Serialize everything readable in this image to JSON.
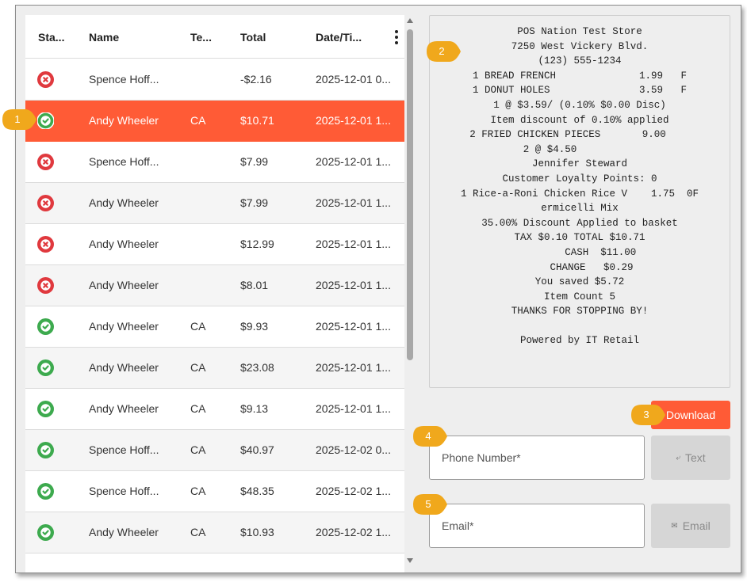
{
  "table": {
    "headers": {
      "status": "Sta...",
      "name": "Name",
      "tender": "Te...",
      "total": "Total",
      "date": "Date/Ti..."
    },
    "rows": [
      {
        "status": "void",
        "name": "Spence Hoff...",
        "tender": "",
        "total": "-$2.16",
        "date": "2025-12-01 0..."
      },
      {
        "status": "complete",
        "name": "Andy Wheeler",
        "tender": "CA",
        "total": "$10.71",
        "date": "2025-12-01 1..."
      },
      {
        "status": "void",
        "name": "Spence Hoff...",
        "tender": "",
        "total": "$7.99",
        "date": "2025-12-01 1..."
      },
      {
        "status": "void",
        "name": "Andy Wheeler",
        "tender": "",
        "total": "$7.99",
        "date": "2025-12-01 1..."
      },
      {
        "status": "void",
        "name": "Andy Wheeler",
        "tender": "",
        "total": "$12.99",
        "date": "2025-12-01 1..."
      },
      {
        "status": "void",
        "name": "Andy Wheeler",
        "tender": "",
        "total": "$8.01",
        "date": "2025-12-01 1..."
      },
      {
        "status": "complete",
        "name": "Andy Wheeler",
        "tender": "CA",
        "total": "$9.93",
        "date": "2025-12-01 1..."
      },
      {
        "status": "complete",
        "name": "Andy Wheeler",
        "tender": "CA",
        "total": "$23.08",
        "date": "2025-12-01 1..."
      },
      {
        "status": "complete",
        "name": "Andy Wheeler",
        "tender": "CA",
        "total": "$9.13",
        "date": "2025-12-01 1..."
      },
      {
        "status": "complete",
        "name": "Spence Hoff...",
        "tender": "CA",
        "total": "$40.97",
        "date": "2025-12-02 0..."
      },
      {
        "status": "complete",
        "name": "Spence Hoff...",
        "tender": "CA",
        "total": "$48.35",
        "date": "2025-12-02 1..."
      },
      {
        "status": "complete",
        "name": "Andy Wheeler",
        "tender": "CA",
        "total": "$10.93",
        "date": "2025-12-02 1..."
      }
    ],
    "selected_row": 1
  },
  "receipt": {
    "lines": [
      "POS Nation Test Store",
      "7250 West Vickery Blvd.",
      "(123) 555-1234",
      "1 BREAD FRENCH              1.99   F",
      "1 DONUT HOLES               3.59   F",
      "1 @ $3.59/ (0.10% $0.00 Disc)",
      "Item discount of 0.10% applied",
      "2 FRIED CHICKEN PIECES       9.00    ",
      "2 @ $4.50          ",
      "Jennifer Steward",
      "Customer Loyalty Points: 0",
      "1 Rice-a-Roni Chicken Rice V    1.75  0F",
      "ermicelli Mix",
      "35.00% Discount Applied to basket",
      "TAX $0.10 TOTAL $10.71",
      "       CASH  $11.00",
      "    CHANGE   $0.29",
      "You saved $5.72",
      "Item Count 5",
      "THANKS FOR STOPPING BY!",
      "",
      "Powered by IT Retail"
    ]
  },
  "actions": {
    "download_label": "Download",
    "phone_placeholder": "Phone Number*",
    "text_label": "Text",
    "email_placeholder": "Email*",
    "email_label": "Email"
  },
  "callouts": [
    "1",
    "2",
    "3",
    "4",
    "5"
  ],
  "colors": {
    "accent": "#ff5b36",
    "complete": "#3daa4e",
    "void": "#e0393e",
    "callout": "#f0a81c"
  },
  "icons": {
    "text_button": "phone-icon",
    "email_button": "envelope-icon",
    "void_status": "x-circle-icon",
    "complete_status": "check-circle-icon"
  }
}
